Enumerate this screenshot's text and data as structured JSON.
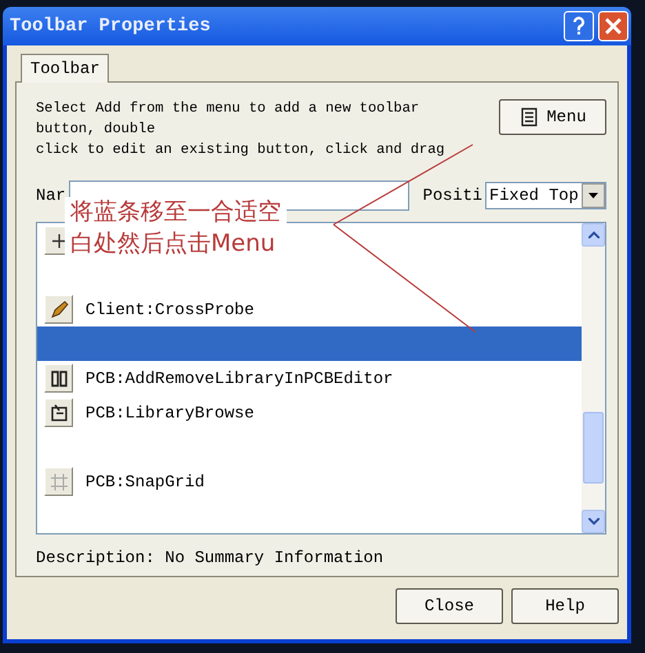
{
  "window": {
    "title": "Toolbar Properties"
  },
  "tabs": [
    {
      "label": "Toolbar",
      "selected": true
    }
  ],
  "instructions": [
    "Select Add from the menu to add a new toolbar",
    "button, double",
    "click to edit an existing button, click and drag"
  ],
  "menu_button": {
    "label": "Menu"
  },
  "name_label": "Nar",
  "position_label": "Positi",
  "position_select": {
    "value": "Fixed Top"
  },
  "commands": [
    {
      "kind": "command",
      "selected": false
    },
    {
      "kind": "separator",
      "selected": false
    },
    {
      "kind": "command",
      "label": "Client:CrossProbe",
      "selected": false
    },
    {
      "kind": "separator",
      "selected": true
    },
    {
      "kind": "command",
      "label": "PCB:AddRemoveLibraryInPCBEditor",
      "selected": false
    },
    {
      "kind": "command",
      "label": "PCB:LibraryBrowse",
      "selected": false
    },
    {
      "kind": "separator",
      "selected": false
    },
    {
      "kind": "command",
      "label": "PCB:SnapGrid",
      "selected": false
    },
    {
      "kind": "separator",
      "selected": false
    }
  ],
  "description": "Description: No Summary Information",
  "annotation": {
    "lines": [
      "将蓝条移至一合适空",
      "白处然后点击Menu"
    ]
  },
  "buttons": [
    "Close",
    "Help"
  ]
}
